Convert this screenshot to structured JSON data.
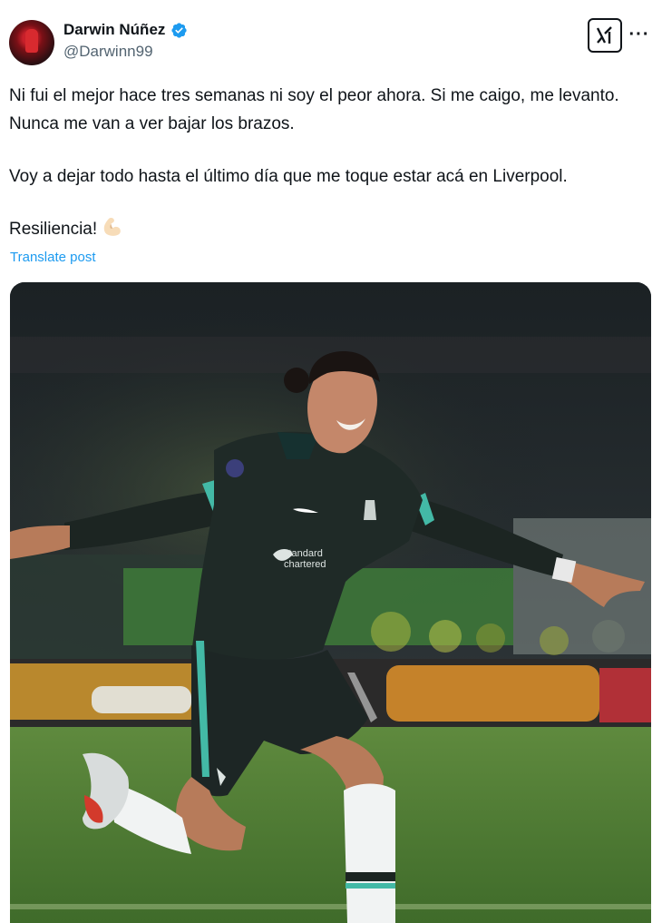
{
  "author": {
    "display_name": "Darwin Núñez",
    "handle": "@Darwinn99",
    "verified": true,
    "avatar_icon": "avatar"
  },
  "actions": {
    "grok_icon": "grok-icon",
    "more_icon": "more-dots-icon",
    "more_label": "···"
  },
  "post": {
    "paragraph1": "Ni fui el mejor hace tres semanas ni soy el peor ahora. Si me caigo, me levanto. Nunca me van a ver bajar los brazos.",
    "paragraph2": "Voy a dejar todo hasta el último día que me toque estar acá en Liverpool.",
    "paragraph3": "Resiliencia!",
    "emoji": "flexed-biceps-icon",
    "translate_label": "Translate post"
  },
  "media": {
    "type": "photo",
    "description_icon": "football-celebration-photo"
  },
  "colors": {
    "link": "#1d9bf0",
    "verified": "#1d9bf0",
    "text": "#0f1419",
    "secondary": "#536471"
  }
}
